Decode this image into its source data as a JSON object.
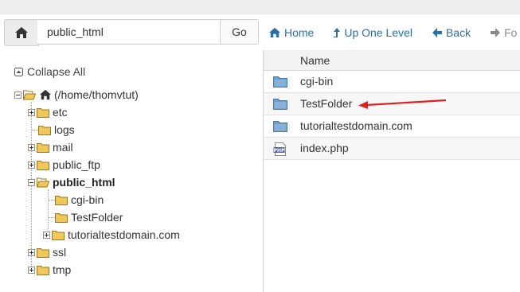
{
  "path_bar": {
    "value": "public_html",
    "go_label": "Go"
  },
  "toolbar": {
    "home_label": "Home",
    "up_label": "Up One Level",
    "back_label": "Back",
    "forward_label": "Fo"
  },
  "tree": {
    "collapse_label": "Collapse All",
    "root_label": "(/home/thomvtut)",
    "items": [
      {
        "label": "etc"
      },
      {
        "label": "logs"
      },
      {
        "label": "mail"
      },
      {
        "label": "public_ftp"
      },
      {
        "label": "public_html"
      },
      {
        "label": "ssl"
      },
      {
        "label": "tmp"
      }
    ],
    "public_html_children": [
      {
        "label": "cgi-bin"
      },
      {
        "label": "TestFolder"
      },
      {
        "label": "tutorialtestdomain.com"
      }
    ]
  },
  "file_list": {
    "column_name": "Name",
    "rows": [
      {
        "name": "cgi-bin",
        "icon": "folder-icon"
      },
      {
        "name": "TestFolder",
        "icon": "folder-icon"
      },
      {
        "name": "tutorialtestdomain.com",
        "icon": "folder-icon"
      },
      {
        "name": "index.php",
        "icon": "php-file-icon"
      }
    ]
  },
  "colors": {
    "link": "#2a6fa8",
    "folder": "#f0c85a",
    "arrow": "#e02020"
  }
}
